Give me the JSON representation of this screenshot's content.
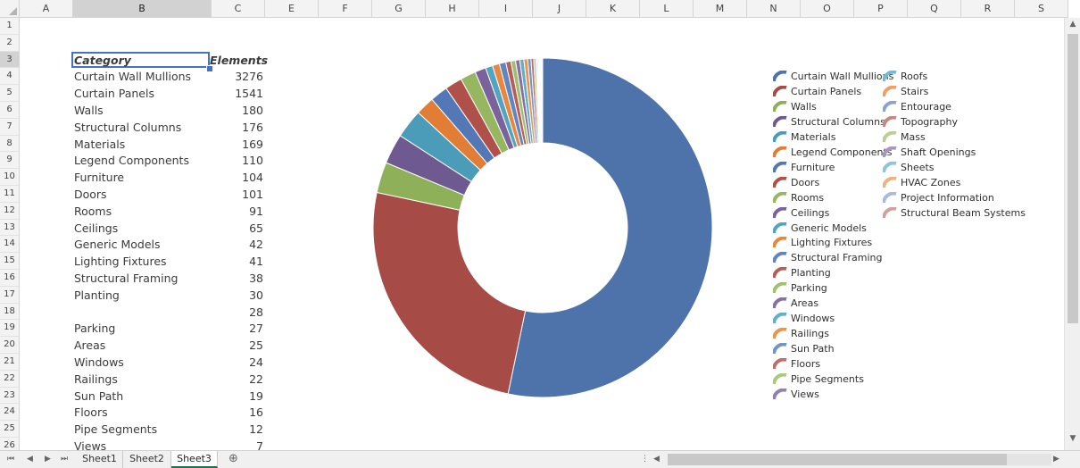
{
  "spreadsheet": {
    "selected_column": "B",
    "selected_row": "3",
    "columns": [
      {
        "label": "A",
        "w": 60
      },
      {
        "label": "B",
        "w": 155
      },
      {
        "label": "C",
        "w": 60
      },
      {
        "label": "E",
        "w": 60
      },
      {
        "label": "F",
        "w": 60
      },
      {
        "label": "G",
        "w": 60
      },
      {
        "label": "H",
        "w": 60
      },
      {
        "label": "I",
        "w": 60
      },
      {
        "label": "J",
        "w": 60
      },
      {
        "label": "K",
        "w": 60
      },
      {
        "label": "L",
        "w": 60
      },
      {
        "label": "M",
        "w": 60
      },
      {
        "label": "N",
        "w": 60
      },
      {
        "label": "O",
        "w": 60
      },
      {
        "label": "P",
        "w": 60
      },
      {
        "label": "Q",
        "w": 60
      },
      {
        "label": "R",
        "w": 60
      },
      {
        "label": "S",
        "w": 60
      }
    ],
    "rows": [
      "1",
      "2",
      "3",
      "4",
      "5",
      "6",
      "7",
      "8",
      "9",
      "10",
      "11",
      "12",
      "13",
      "14",
      "15",
      "16",
      "17",
      "18",
      "19",
      "20",
      "21",
      "22",
      "23",
      "24",
      "25",
      "26"
    ],
    "table": {
      "category_header": "Category",
      "elements_header": "Elements",
      "records": [
        {
          "row": 4,
          "category": "Curtain Wall Mullions",
          "elements": "3276"
        },
        {
          "row": 5,
          "category": "Curtain Panels",
          "elements": "1541"
        },
        {
          "row": 6,
          "category": "Walls",
          "elements": "180"
        },
        {
          "row": 7,
          "category": "Structural Columns",
          "elements": "176"
        },
        {
          "row": 8,
          "category": "Materials",
          "elements": "169"
        },
        {
          "row": 9,
          "category": "Legend Components",
          "elements": "110"
        },
        {
          "row": 10,
          "category": "Furniture",
          "elements": "104"
        },
        {
          "row": 11,
          "category": "Doors",
          "elements": "101"
        },
        {
          "row": 12,
          "category": "Rooms",
          "elements": "91"
        },
        {
          "row": 13,
          "category": "Ceilings",
          "elements": "65"
        },
        {
          "row": 14,
          "category": "Generic Models",
          "elements": "42"
        },
        {
          "row": 15,
          "category": "Lighting Fixtures",
          "elements": "41"
        },
        {
          "row": 16,
          "category": "Structural Framing",
          "elements": "38"
        },
        {
          "row": 17,
          "category": "Planting",
          "elements": "30"
        },
        {
          "row": 18,
          "category": "",
          "elements": "28"
        },
        {
          "row": 19,
          "category": "Parking",
          "elements": "27"
        },
        {
          "row": 20,
          "category": "Areas",
          "elements": "25"
        },
        {
          "row": 21,
          "category": "Windows",
          "elements": "24"
        },
        {
          "row": 22,
          "category": "Railings",
          "elements": "22"
        },
        {
          "row": 23,
          "category": "Sun Path",
          "elements": "19"
        },
        {
          "row": 24,
          "category": "Floors",
          "elements": "16"
        },
        {
          "row": 25,
          "category": "Pipe Segments",
          "elements": "12"
        },
        {
          "row": 26,
          "category": "Views",
          "elements": "7"
        }
      ]
    }
  },
  "chart_data": {
    "type": "pie",
    "donut": true,
    "legend_position": "right",
    "slices": [
      {
        "label": "Curtain Wall Mullions",
        "value": 3276,
        "color": "#4e72aa"
      },
      {
        "label": "Curtain Panels",
        "value": 1541,
        "color": "#a64b45"
      },
      {
        "label": "Walls",
        "value": 180,
        "color": "#8db059"
      },
      {
        "label": "Structural Columns",
        "value": 176,
        "color": "#6e5a91"
      },
      {
        "label": "Materials",
        "value": 169,
        "color": "#4b9cb8"
      },
      {
        "label": "Legend Components",
        "value": 110,
        "color": "#e27d35"
      },
      {
        "label": "Furniture",
        "value": 104,
        "color": "#5478b5"
      },
      {
        "label": "Doors",
        "value": 101,
        "color": "#b0504a"
      },
      {
        "label": "Rooms",
        "value": 91,
        "color": "#96b75f"
      },
      {
        "label": "Ceilings",
        "value": 65,
        "color": "#7a629c"
      },
      {
        "label": "Generic Models",
        "value": 42,
        "color": "#52a5c2"
      },
      {
        "label": "Lighting Fixtures",
        "value": 41,
        "color": "#e8883f"
      },
      {
        "label": "Structural Framing",
        "value": 38,
        "color": "#6285c0"
      },
      {
        "label": "Planting",
        "value": 30,
        "color": "#b85e58"
      },
      {
        "label": "Parking",
        "value": 27,
        "color": "#a1c06e"
      },
      {
        "label": "Areas",
        "value": 25,
        "color": "#8670a6"
      },
      {
        "label": "Windows",
        "value": 24,
        "color": "#62afcb"
      },
      {
        "label": "Railings",
        "value": 22,
        "color": "#ec944e"
      },
      {
        "label": "Sun Path",
        "value": 19,
        "color": "#7294c8"
      },
      {
        "label": "Floors",
        "value": 16,
        "color": "#c06f69"
      },
      {
        "label": "Pipe Segments",
        "value": 12,
        "color": "#abc87f"
      },
      {
        "label": "Views",
        "value": 7,
        "color": "#937fb0"
      },
      {
        "label": "Roofs",
        "value": 6,
        "color": "#73bad3"
      },
      {
        "label": "Stairs",
        "value": 6,
        "color": "#efa062"
      },
      {
        "label": "Entourage",
        "value": 5,
        "color": "#8ca5d0"
      },
      {
        "label": "Topography",
        "value": 4,
        "color": "#c98781"
      },
      {
        "label": "Mass",
        "value": 3,
        "color": "#b8d193"
      },
      {
        "label": "Shaft Openings",
        "value": 3,
        "color": "#a797c0"
      },
      {
        "label": "Sheets",
        "value": 2,
        "color": "#8ac6dc"
      },
      {
        "label": "HVAC Zones",
        "value": 2,
        "color": "#f2b07e"
      },
      {
        "label": "Project Information",
        "value": 1,
        "color": "#a9bcdc"
      },
      {
        "label": "Structural Beam Systems",
        "value": 1,
        "color": "#d3a19c"
      }
    ]
  },
  "sheets": {
    "tabs": [
      "Sheet1",
      "Sheet2",
      "Sheet3"
    ],
    "active": "Sheet3",
    "add_icon": "plus-circle-icon"
  }
}
